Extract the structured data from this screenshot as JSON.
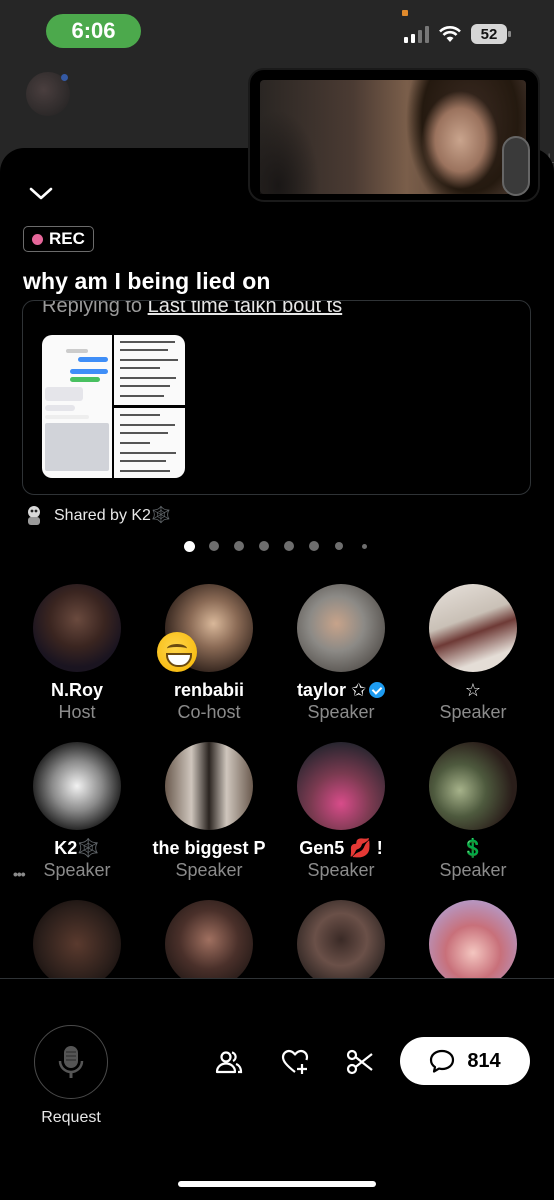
{
  "status_bar": {
    "time": "6:06",
    "battery": "52"
  },
  "space": {
    "rec_label": "REC",
    "title": "why am I being lied on",
    "reply_prefix": "Replying to ",
    "reply_target": "Last time talkn bout ts",
    "shared_by": "Shared by K2🕸️",
    "page_count": 8,
    "active_page": 0
  },
  "participants": [
    {
      "name": "N.Roy",
      "role": "Host"
    },
    {
      "name": "renbabii",
      "role": "Co-host"
    },
    {
      "name": "taylor ✩",
      "role": "Speaker",
      "verified": true
    },
    {
      "name": "☆",
      "role": "Speaker"
    },
    {
      "name": "K2🕸️",
      "role": "Speaker",
      "more": "•••"
    },
    {
      "name": "the biggest P",
      "role": "Speaker"
    },
    {
      "name": "Gen5 💋 !",
      "role": "Speaker"
    },
    {
      "name": "💲",
      "role": "Speaker"
    },
    {
      "name": "",
      "role": ""
    },
    {
      "name": "",
      "role": ""
    },
    {
      "name": "",
      "role": ""
    },
    {
      "name": "",
      "role": ""
    }
  ],
  "bottom_bar": {
    "request_label": "Request",
    "comment_count": "814"
  },
  "colors": {
    "rec": "#e6679a",
    "status_green": "#4ca94c",
    "verified": "#1d9bf0"
  },
  "icons": [
    "chevron-down-icon",
    "microphone-icon",
    "people-icon",
    "heart-plus-icon",
    "scissors-icon",
    "comment-icon"
  ]
}
